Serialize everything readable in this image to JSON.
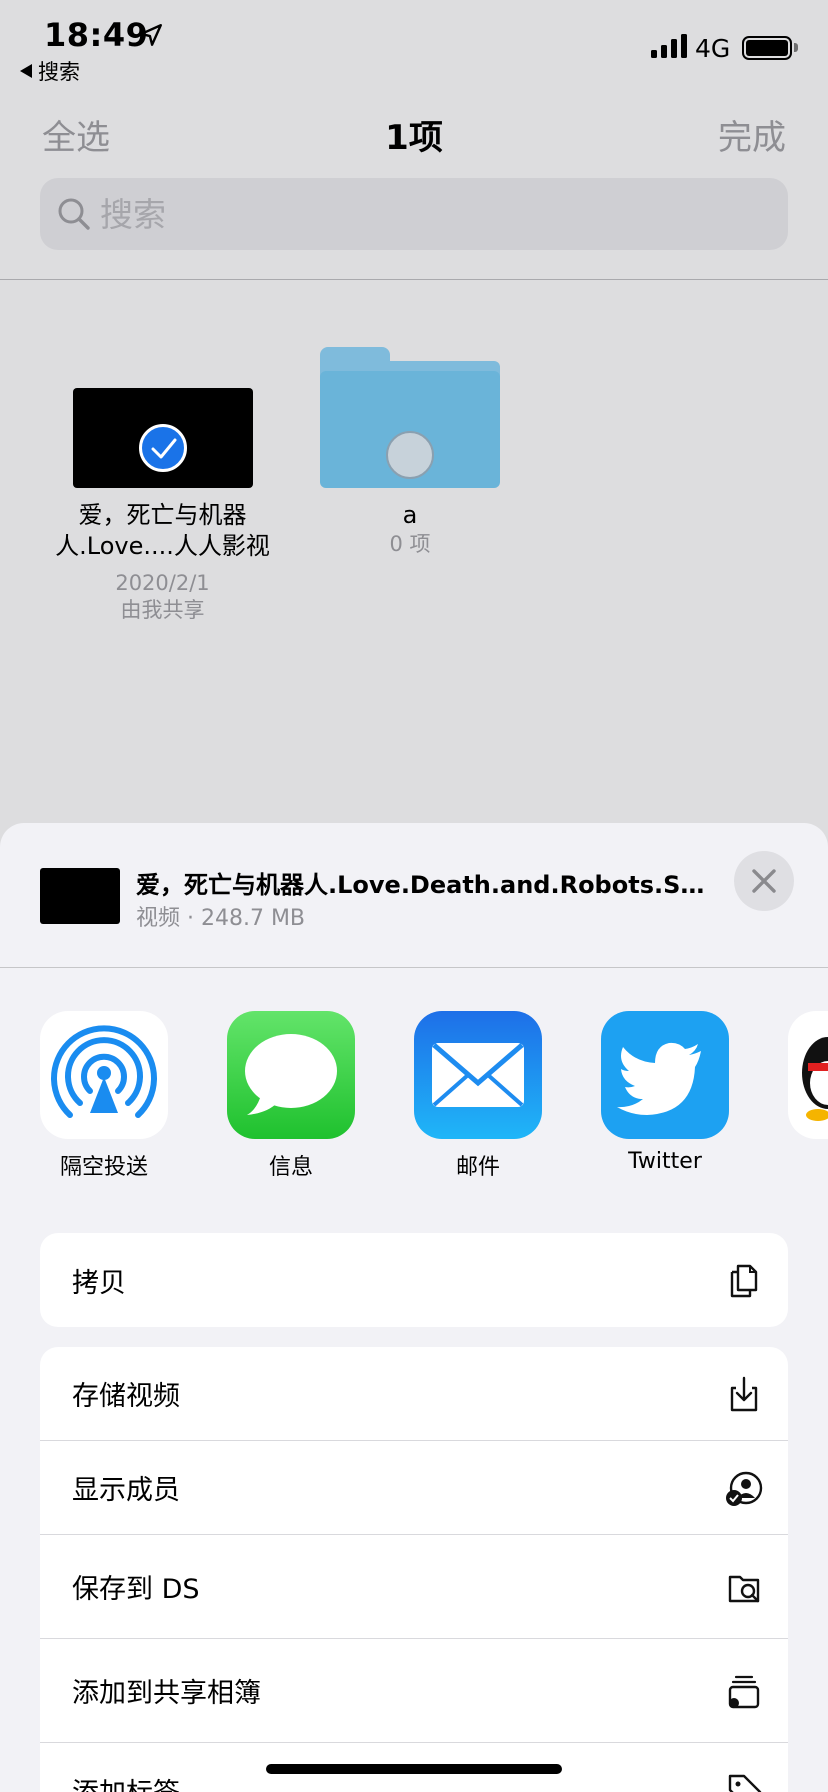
{
  "status_bar": {
    "time": "18:49",
    "back_app": "搜索",
    "network": "4G"
  },
  "nav": {
    "select_all": "全选",
    "title": "1项",
    "done": "完成"
  },
  "search": {
    "placeholder": "搜索"
  },
  "files": [
    {
      "name_line1": "爱，死亡与机器",
      "name_line2": "人.Love....人人影视",
      "date": "2020/2/1",
      "shared": "由我共享",
      "selected": true
    },
    {
      "name": "a",
      "count": "0 项",
      "selected": false
    }
  ],
  "share_sheet": {
    "title": "爱，死亡与机器人.Love.Death.and.Robots.S01E...",
    "subtitle": "视频 · 248.7 MB",
    "apps": [
      {
        "label": "隔空投送",
        "icon": "airdrop-icon"
      },
      {
        "label": "信息",
        "icon": "messages-icon"
      },
      {
        "label": "邮件",
        "icon": "mail-icon"
      },
      {
        "label": "Twitter",
        "icon": "twitter-icon"
      },
      {
        "label": "",
        "icon": "qq-icon"
      }
    ],
    "actions_group1": [
      {
        "label": "拷贝",
        "icon": "copy-icon"
      }
    ],
    "actions_group2": [
      {
        "label": "存储视频",
        "icon": "download-icon"
      },
      {
        "label": "显示成员",
        "icon": "members-icon"
      },
      {
        "label": "保存到 DS",
        "icon": "folder-search-icon"
      },
      {
        "label": "添加到共享相簿",
        "icon": "shared-album-icon"
      },
      {
        "label": "添加标签",
        "icon": "tag-icon"
      }
    ]
  },
  "colors": {
    "accent_blue": "#1a73e8",
    "folder_blue": "#6ab4d9",
    "messages_green": "#34c759",
    "twitter_blue": "#1da1f2"
  }
}
